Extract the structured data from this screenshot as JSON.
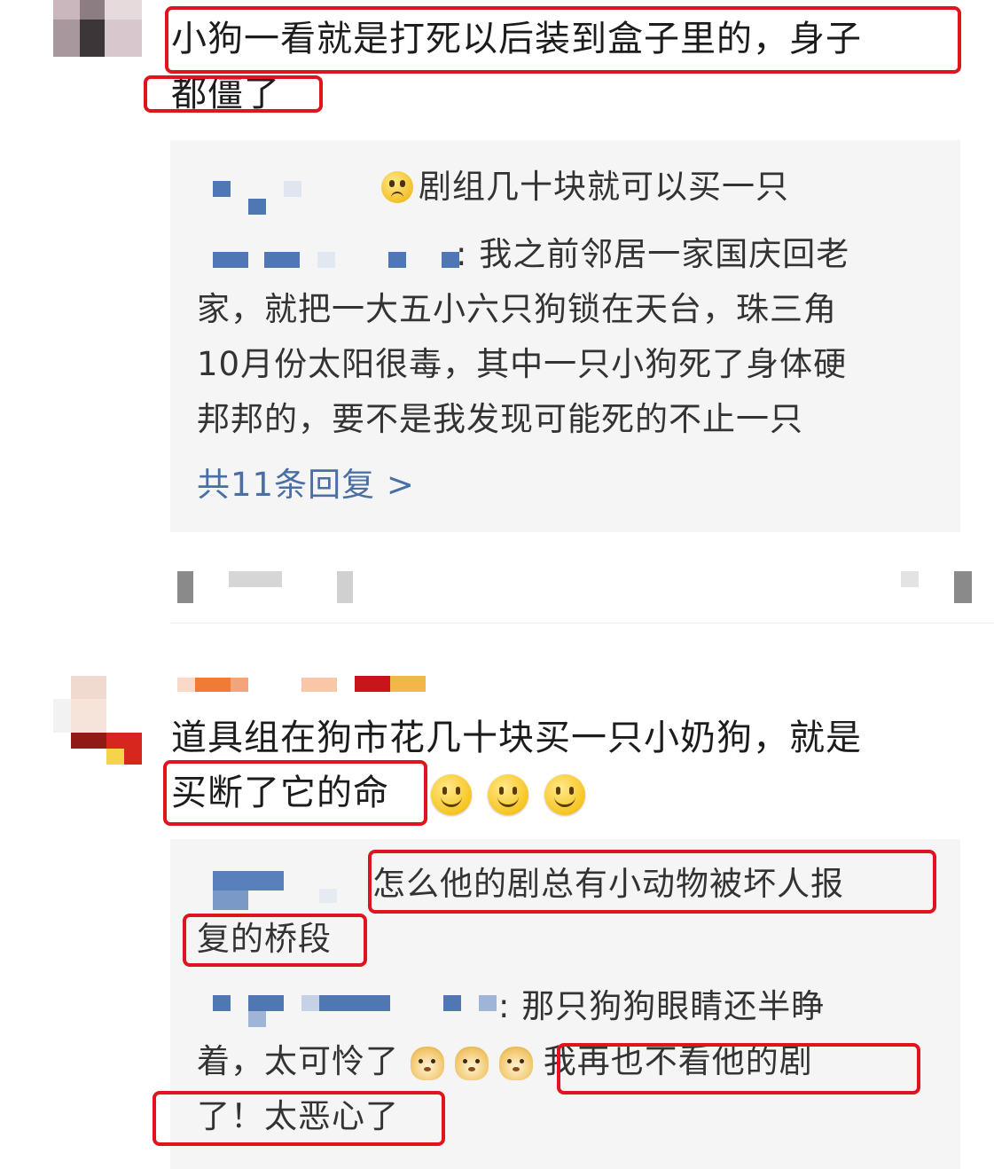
{
  "comment1": {
    "text_line1": "小狗一看就是打死以后装到盒子里的，身子",
    "text_line2": "都僵了",
    "replies": {
      "reply1_text": "剧组几十块就可以买一只",
      "reply2_line1": ": 我之前邻居一家国庆回老",
      "reply2_line2": "家，就把一大五小六只狗锁在天台，珠三角",
      "reply2_line3": "10月份太阳很毒，其中一只小狗死了身体硬",
      "reply2_line4": "邦邦的，要不是我发现可能死的不止一只",
      "more_link": "共11条回复 >"
    }
  },
  "comment2": {
    "text_line1": "道具组在狗市花几十块买一只小奶狗，就是",
    "text_line2": "买断了它的命",
    "replies": {
      "reply1_line1": "怎么他的剧总有小动物被坏人报",
      "reply1_line2": "复的桥段",
      "reply2_line1": ": 那只狗狗眼睛还半睁",
      "reply2_line2a": "着，太可怜了",
      "reply2_line2b": "我再也不看他的剧",
      "reply2_line3": "了！太恶心了"
    }
  },
  "colors": {
    "highlight": "#e0141e",
    "link": "#4a6fa5",
    "reply_bg": "#f5f5f5",
    "mosaic_blue": "#4f77b3"
  },
  "icons": [
    "sad-face-emoji-icon",
    "smile-emoji-icon",
    "dog-emoji-icon"
  ]
}
